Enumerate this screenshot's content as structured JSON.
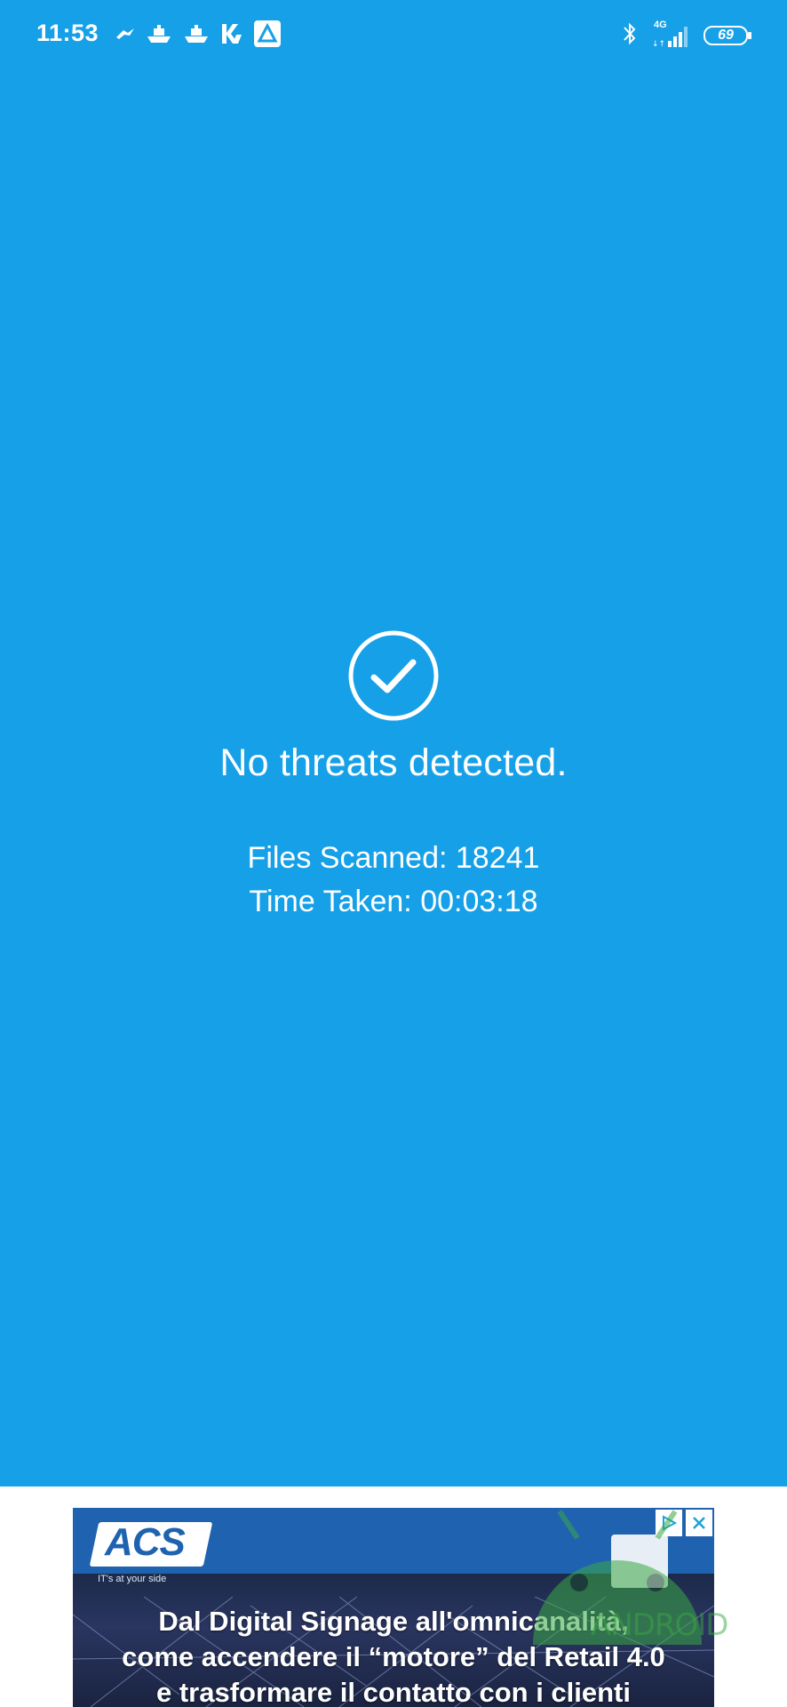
{
  "status_bar": {
    "time": "11:53",
    "notification_icons": [
      "bird-icon",
      "ship-icon",
      "ship-icon",
      "kaspersky-icon",
      "app-icon"
    ],
    "network_label": "4G",
    "battery_level": "69",
    "bluetooth": true
  },
  "scan_result": {
    "icon": "check-circle-icon",
    "headline": "No threats detected.",
    "files_scanned": "Files Scanned: 18241",
    "time_taken": "Time Taken: 00:03:18"
  },
  "ad": {
    "brand": "ACS",
    "tagline": "IT's at your side",
    "headline_line1": "Dal Digital Signage all'omnicanalità,",
    "headline_line2": "come accendere il “motore” del Retail 4.0",
    "headline_line3": "e trasformare il contatto con i clienti"
  },
  "watermark": {
    "text": "ANDROID"
  },
  "colors": {
    "background": "#16a0e8",
    "text": "#ffffff",
    "ad_blue": "#1f63b0"
  }
}
